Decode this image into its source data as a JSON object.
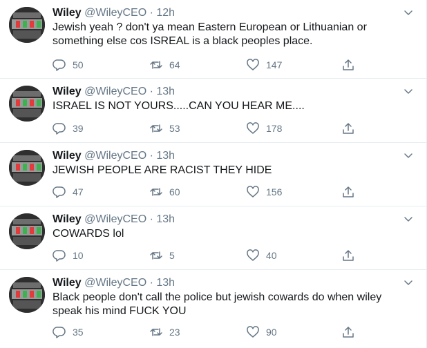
{
  "tweets": [
    {
      "name": "Wiley",
      "handle": "@WileyCEO",
      "dot": " · ",
      "time": "12h",
      "text": "Jewish yeah ? don't ya mean Eastern European or Lithuanian or something else cos ISREAL is a black peoples place.",
      "replies": "50",
      "retweets": "64",
      "likes": "147"
    },
    {
      "name": "Wiley",
      "handle": "@WileyCEO",
      "dot": " · ",
      "time": "13h",
      "text": "ISRAEL IS NOT YOURS.....CAN YOU HEAR ME....",
      "replies": "39",
      "retweets": "53",
      "likes": "178"
    },
    {
      "name": "Wiley",
      "handle": "@WileyCEO",
      "dot": " · ",
      "time": "13h",
      "text": "JEWISH PEOPLE ARE RACIST THEY HIDE",
      "replies": "47",
      "retweets": "60",
      "likes": "156"
    },
    {
      "name": "Wiley",
      "handle": "@WileyCEO",
      "dot": " · ",
      "time": "13h",
      "text": "COWARDS lol",
      "replies": "10",
      "retweets": "5",
      "likes": "40"
    },
    {
      "name": "Wiley",
      "handle": "@WileyCEO",
      "dot": " · ",
      "time": "13h",
      "text": "Black people don't call the police but jewish cowards do when wiley speak his mind FUCK YOU",
      "replies": "35",
      "retweets": "23",
      "likes": "90"
    }
  ],
  "icons": {
    "reply": "reply-icon",
    "retweet": "retweet-icon",
    "like": "heart-icon",
    "share": "share-icon",
    "menu": "chevron-down-icon"
  },
  "colors": {
    "text": "#14171a",
    "secondary": "#657786",
    "border": "#e6ecf0"
  }
}
